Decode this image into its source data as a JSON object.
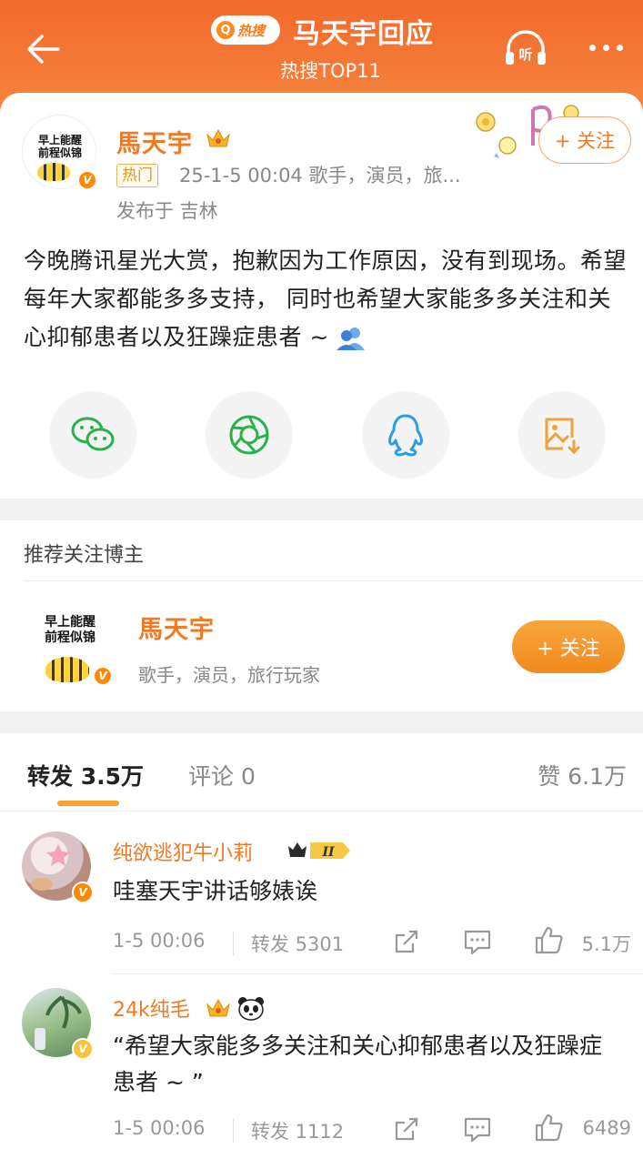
{
  "header": {
    "badge_text": "热搜",
    "title": "马天宇回应",
    "subtitle": "热搜TOP11",
    "listen_label": "听"
  },
  "post": {
    "avatar_text": "早上能醒\n前程似锦",
    "author": "馬天宇",
    "tag": "热门",
    "meta": "25-1-5 00:04   歌手，演员，旅...",
    "location": "发布于 吉林",
    "follow_label": "+ 关注",
    "text": "今晚腾讯星光大赏，抱歉因为工作原因，没有到现场。希望每年大家都能多多支持， 同时也希望大家能多多关注和关心抑郁患者以及狂躁症患者 ~ "
  },
  "recommend": {
    "title": "推荐关注博主",
    "avatar_text": "早上能醒\n前程似锦",
    "name": "馬天宇",
    "desc": "歌手，演员，旅行玩家",
    "follow_label": "+ 关注"
  },
  "tabs": {
    "repost": "转发 3.5万",
    "comment": "评论 0",
    "like": "赞 6.1万"
  },
  "items": [
    {
      "name": "纯欲逃犯牛小莉",
      "level": "II",
      "text": "哇塞天宇讲话够婊诶",
      "time": "1-5 00:06",
      "repost": "转发 5301",
      "likes": "5.1万"
    },
    {
      "name": "24k纯毛",
      "text": "“希望大家能多多关注和关心抑郁患者以及狂躁症患者 ~ ”",
      "time": "1-5 00:06",
      "repost": "转发 1112",
      "likes": "6489"
    }
  ],
  "colors": {
    "brand_orange": "#f07a24",
    "header_gradient_top": "#f26a2c",
    "follow_fill": "#f28a1e",
    "underline": "#f7a22d"
  }
}
